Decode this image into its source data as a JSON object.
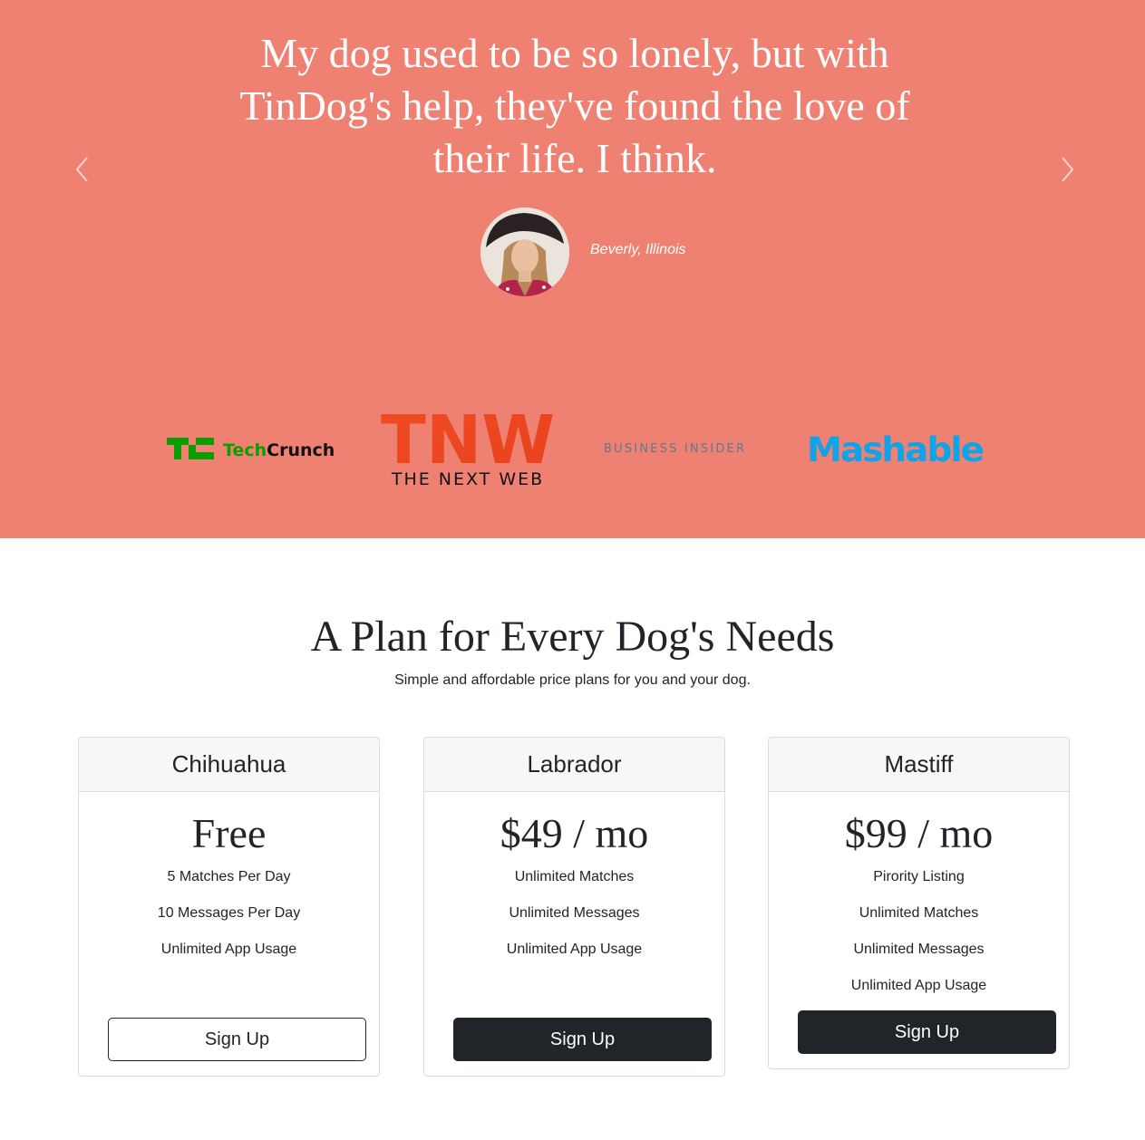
{
  "colors": {
    "testimonial_bg": "#ef8172",
    "dark": "#212529",
    "techcrunch_green": "#0a9e01",
    "tnw_red": "#f44336",
    "mashable_blue": "#0fa3e9",
    "bi_gray": "#7d8a96"
  },
  "testimonial": {
    "quote": "My dog used to be so lonely, but with TinDog's help, they've found the love of their life. I think.",
    "author": "Beverly, Illinois",
    "prev_icon": "chevron-left-icon",
    "next_icon": "chevron-right-icon"
  },
  "press": {
    "techcrunch": {
      "tech": "Tech",
      "crunch": "Crunch"
    },
    "tnw": {
      "mark": "TNW",
      "name": "THE NEXT WEB"
    },
    "business_insider": "BUSINESS INSIDER",
    "mashable": "Mashable"
  },
  "pricing": {
    "title": "A Plan for Every Dog's Needs",
    "subtitle": "Simple and affordable price plans for you and your dog.",
    "plans": [
      {
        "name": "Chihuahua",
        "price": "Free",
        "features": [
          "5 Matches Per Day",
          "10 Messages Per Day",
          "Unlimited App Usage"
        ],
        "button": "Sign Up"
      },
      {
        "name": "Labrador",
        "price": "$49 / mo",
        "features": [
          "Unlimited Matches",
          "Unlimited Messages",
          "Unlimited App Usage"
        ],
        "button": "Sign Up"
      },
      {
        "name": "Mastiff",
        "price": "$99 / mo",
        "features": [
          "Pirority Listing",
          "Unlimited Matches",
          "Unlimited Messages",
          "Unlimited App Usage"
        ],
        "button": "Sign Up"
      }
    ]
  }
}
